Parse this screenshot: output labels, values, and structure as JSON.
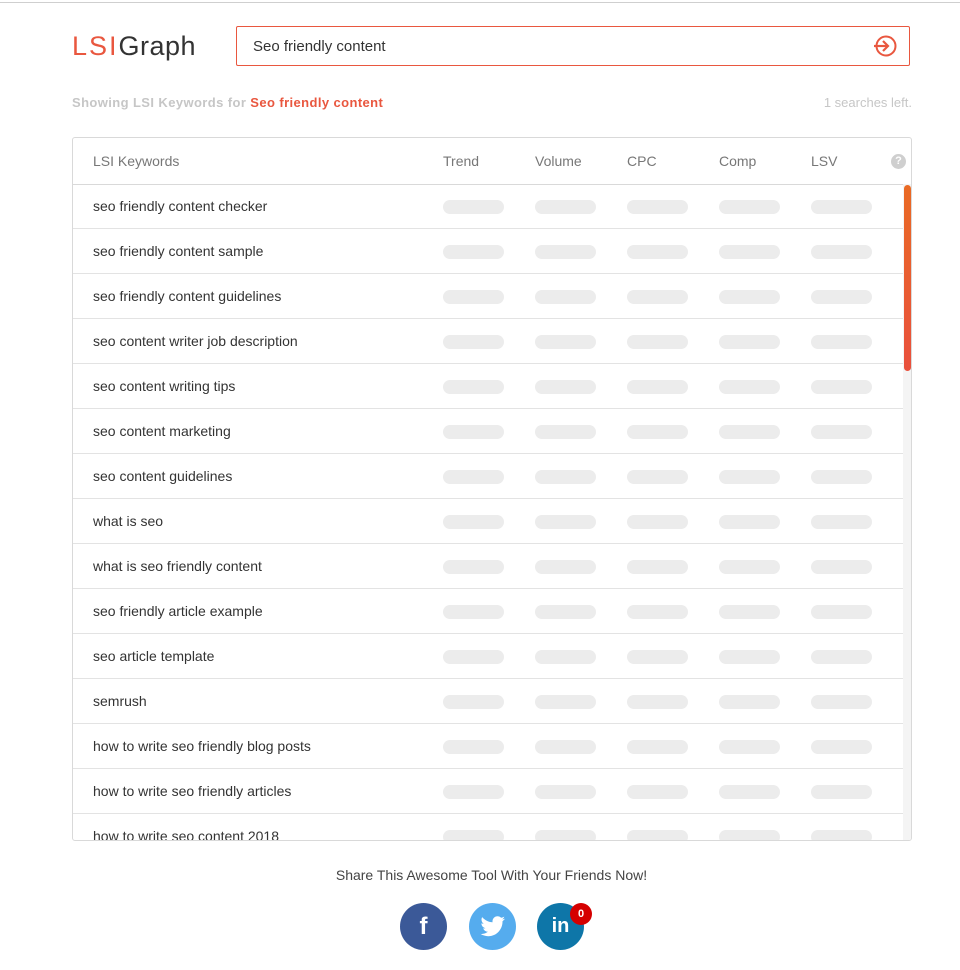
{
  "brand": {
    "part1": "LSI",
    "part2": "Graph"
  },
  "search": {
    "value": "Seo friendly content",
    "placeholder": ""
  },
  "status": {
    "showing_prefix": "Showing LSI Keywords for",
    "showing_keyword": "Seo friendly content",
    "searches_left": "1 searches left."
  },
  "table": {
    "headers": [
      "LSI Keywords",
      "Trend",
      "Volume",
      "CPC",
      "Comp",
      "LSV"
    ],
    "help_glyph": "?",
    "rows": [
      "seo friendly content checker",
      "seo friendly content sample",
      "seo friendly content guidelines",
      "seo content writer job description",
      "seo content writing tips",
      "seo content marketing",
      "seo content guidelines",
      "what is seo",
      "what is seo friendly content",
      "seo friendly article example",
      "seo article template",
      "semrush",
      "how to write seo friendly blog posts",
      "how to write seo friendly articles",
      "how to write seo content 2018"
    ]
  },
  "share": {
    "text": "Share This Awesome Tool With Your Friends Now!",
    "facebook_glyph": "f",
    "linkedin_glyph": "in",
    "linkedin_count": "0"
  },
  "colors": {
    "accent": "#e9573f",
    "facebook": "#3b5998",
    "twitter": "#55acee",
    "linkedin": "#0e76a8",
    "badge": "#d50000"
  },
  "icons": {
    "submit": "sign-in-arrow-icon",
    "help": "question-circle-icon",
    "twitter": "twitter-bird-icon"
  }
}
